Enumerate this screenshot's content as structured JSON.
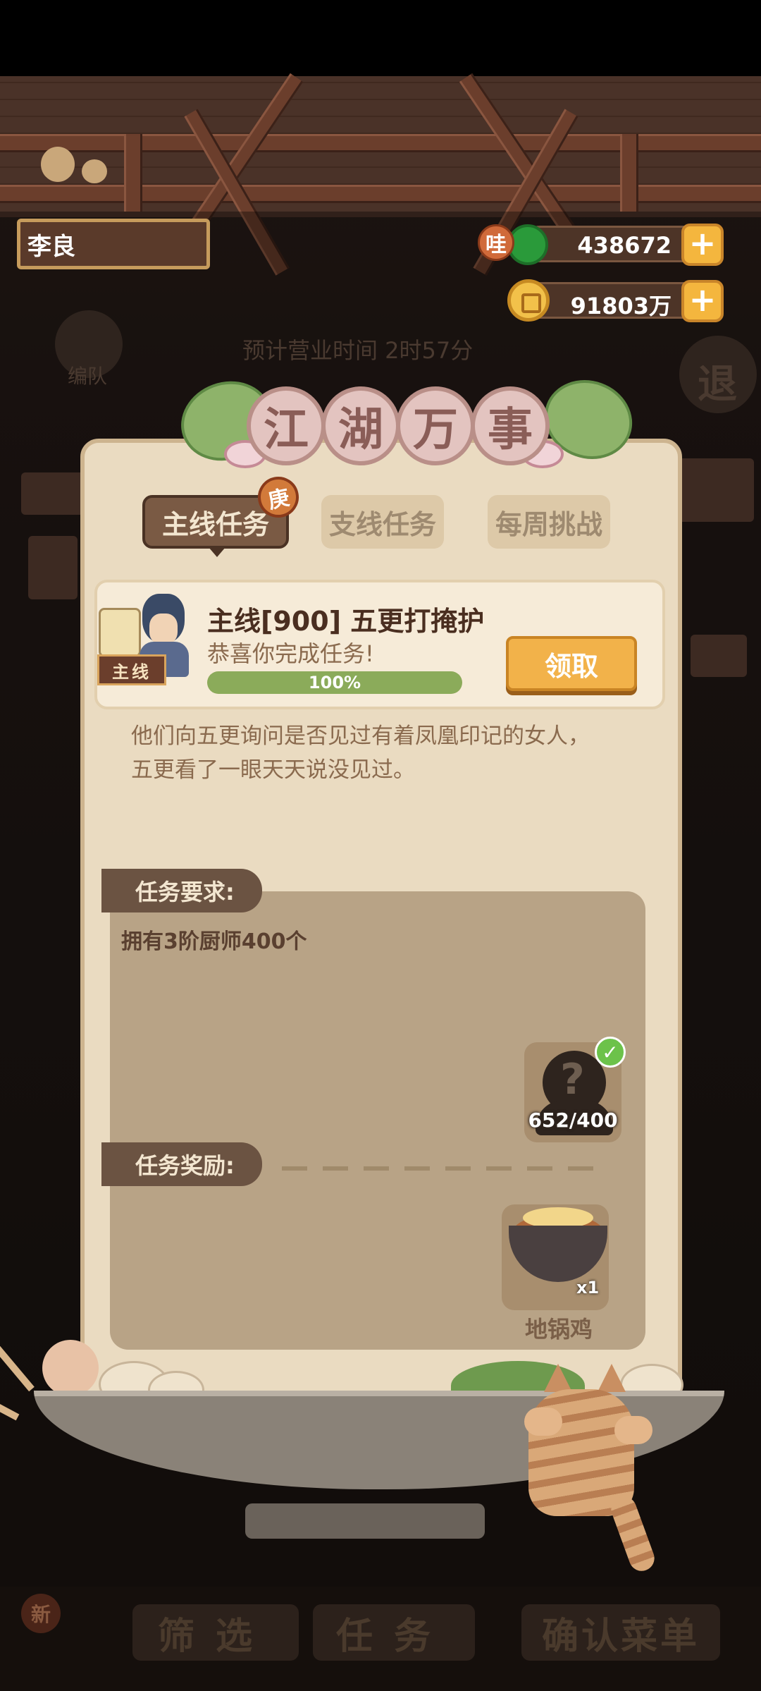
{
  "player": {
    "name": "李良"
  },
  "currencies": {
    "jade": {
      "badge": "哇",
      "value": "438672",
      "icon": "jade-icon"
    },
    "coins": {
      "value": "91803万",
      "icon": "coin-icon"
    }
  },
  "background": {
    "team_label": "编队",
    "business_time": "预计营业时间  2时57分",
    "exit_label": "退",
    "new_badge": "新",
    "filter_label": "筛选",
    "task_label": "任务",
    "confirm_menu_label": "确认菜单"
  },
  "panel": {
    "title_chars": [
      "江",
      "湖",
      "万",
      "事"
    ],
    "tabs": [
      {
        "label": "主线任务",
        "active": true,
        "badge": "庚"
      },
      {
        "label": "支线任务",
        "active": false
      },
      {
        "label": "每周挑战",
        "active": false
      }
    ],
    "quest": {
      "tag": "主线",
      "title": "主线[900] 五更打掩护",
      "subtitle": "恭喜你完成任务!",
      "progress_percent": 100,
      "progress_label": "100%",
      "claim_label": "领取"
    },
    "description_line1": "他们向五更询问是否见过有着凤凰印记的女人，",
    "description_line2": "五更看了一眼天天说没见过。",
    "requirement": {
      "label": "任务要求:",
      "text": "拥有3阶厨师400个",
      "count": "652/400"
    },
    "reward": {
      "label": "任务奖励:",
      "qty": "x1",
      "name": "地锅鸡"
    }
  },
  "colors": {
    "panel_bg": "#eadbc1",
    "tab_active": "#7a5a44",
    "claim_button": "#f2b24a",
    "progress_fill": "#8bab5a",
    "plus_button": "#f4b63e"
  }
}
